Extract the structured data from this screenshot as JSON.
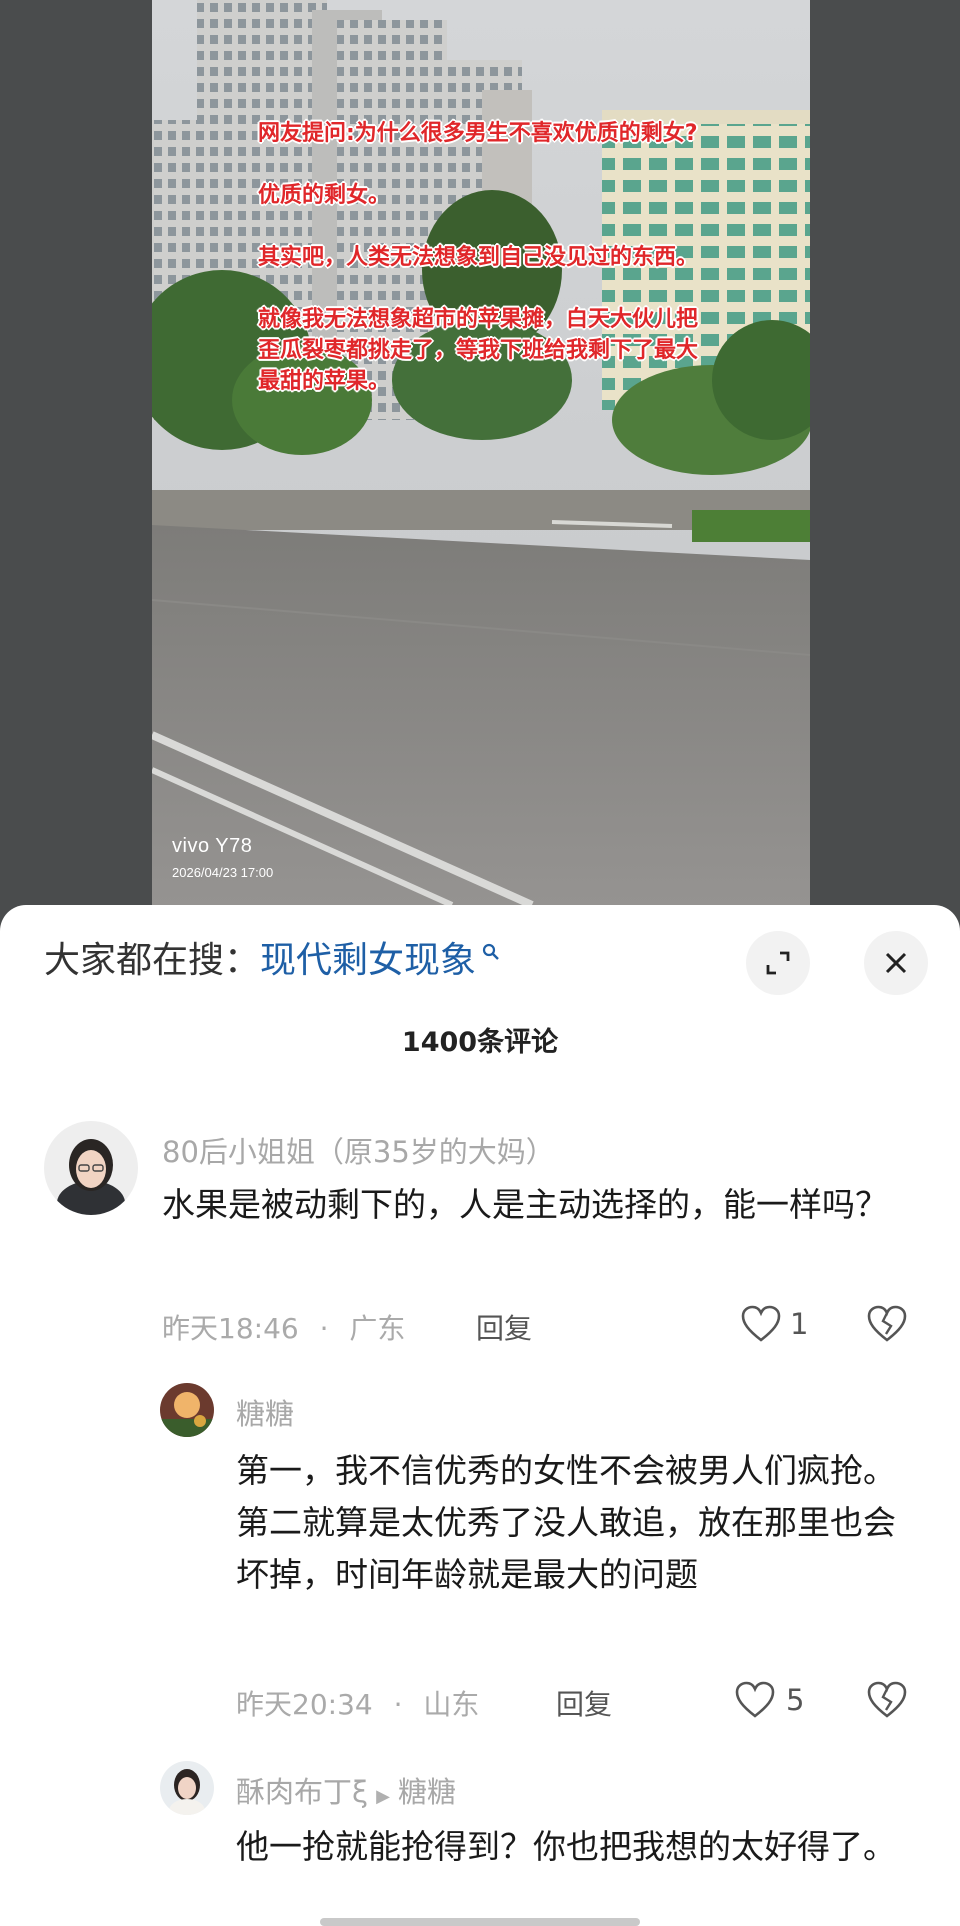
{
  "video": {
    "caption_lines": [
      "网友提问:为什么很多男生不喜欢优质的剩女?",
      "优质的剩女。",
      "其实吧，人类无法想象到自己没见过的东西。",
      "就像我无法想象超市的苹果摊，白天大伙儿把歪瓜裂枣都挑走了，等我下班给我剩下了最大最甜的苹果。"
    ],
    "watermark_brand": "vivo Y78",
    "watermark_date": "2026/04/23 17:00"
  },
  "sheet": {
    "search_prefix": "大家都在搜：",
    "search_term": "现代剩女现象",
    "comment_count": "1400条评论"
  },
  "comments": [
    {
      "username": "80后小姐姐（原35岁的大妈）",
      "text": "水果是被动剩下的，人是主动选择的，能一样吗？",
      "time": "昨天18:46",
      "location": "广东",
      "reply_label": "回复",
      "likes": "1"
    },
    {
      "username": "糖糖",
      "text": "第一，我不信优秀的女性不会被男人们疯抢。第二就算是太优秀了没人敢追，放在那里也会坏掉，时间年龄就是最大的问题",
      "time": "昨天20:34",
      "location": "山东",
      "reply_label": "回复",
      "likes": "5"
    },
    {
      "username": "酥肉布丁ξ",
      "reply_to": "糖糖",
      "text": "他一抢就能抢得到？你也把我想的太好得了。"
    }
  ],
  "meta_separator": "·",
  "colors": {
    "search_term": "#1e5fa6",
    "caption_red": "#e0272a"
  }
}
